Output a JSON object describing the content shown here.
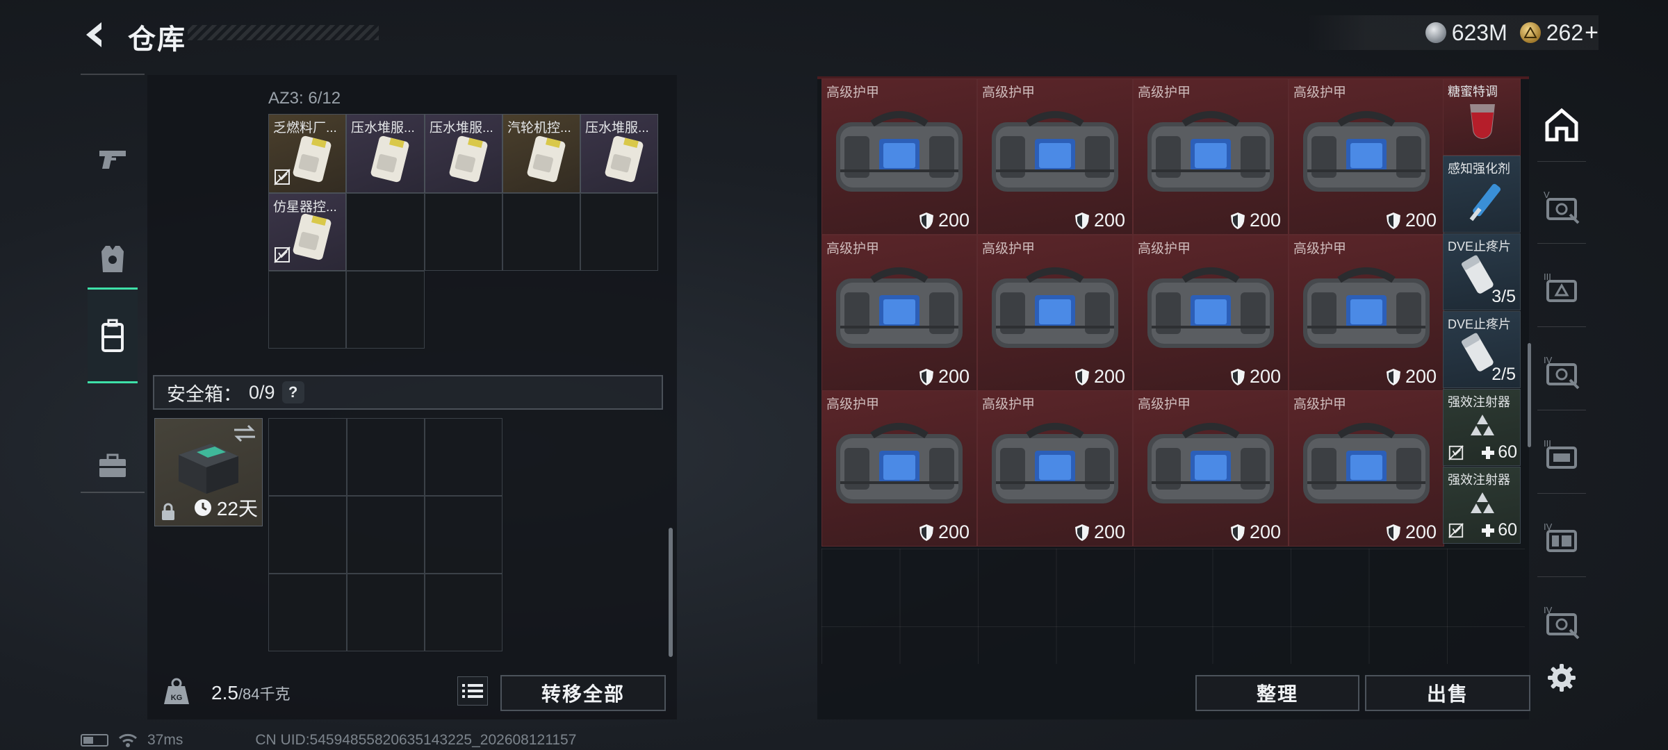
{
  "header": {
    "title": "仓库",
    "currencies": [
      {
        "icon": "silver-coin-icon",
        "value": "623M"
      },
      {
        "icon": "gold-coin-icon",
        "value": "262"
      }
    ],
    "plus": "+"
  },
  "left_tabs": [
    {
      "icon": "pistol-icon",
      "active": false
    },
    {
      "icon": "body-armor-icon",
      "active": false
    },
    {
      "icon": "backpack-icon",
      "active": true
    },
    {
      "icon": "briefcase-icon",
      "active": false
    }
  ],
  "container": {
    "label": "AZ3: 6/12",
    "items": [
      {
        "name": "乏燃料厂...",
        "untradeable": true
      },
      {
        "name": "压水堆服...",
        "untradeable": false
      },
      {
        "name": "压水堆服...",
        "untradeable": false
      },
      {
        "name": "汽轮机控...",
        "untradeable": false
      },
      {
        "name": "压水堆服...",
        "untradeable": false
      },
      {
        "name": "仿星器控...",
        "untradeable": true
      }
    ]
  },
  "safe_box": {
    "label": "安全箱：",
    "count": "0/9",
    "help": "?",
    "duration": "22天"
  },
  "weight": {
    "current": "2.5",
    "max": "/84千克"
  },
  "buttons": {
    "transfer_all": "转移全部",
    "organize": "整理",
    "sell": "出售"
  },
  "stash": {
    "armor": {
      "name": "高级护甲",
      "durability": "200"
    },
    "small_items": [
      {
        "name": "糖蜜特调",
        "value": ""
      },
      {
        "name": "感知强化剂",
        "value": ""
      },
      {
        "name": "DVE止疼片",
        "value": "3/5"
      },
      {
        "name": "DVE止疼片",
        "value": "2/5"
      },
      {
        "name": "强效注射器",
        "value": "60"
      },
      {
        "name": "强效注射器",
        "value": "60"
      }
    ]
  },
  "right_tabs": [
    {
      "icon": "stash-home-icon",
      "label": ""
    },
    {
      "icon": "tier-v-case-icon",
      "label": "V"
    },
    {
      "icon": "tier-iii-case-icon",
      "label": "III"
    },
    {
      "icon": "tier-iv-case-icon",
      "label": "IV"
    },
    {
      "icon": "tier-iii-case-icon",
      "label": "III"
    },
    {
      "icon": "tier-iv-case-icon",
      "label": "IV"
    },
    {
      "icon": "tier-iv-case-icon",
      "label": "IV"
    },
    {
      "icon": "settings-gear-icon",
      "label": ""
    }
  ],
  "status": {
    "ping": "37ms",
    "uid": "CN UID:5459485582063514322​5_202608121157"
  }
}
